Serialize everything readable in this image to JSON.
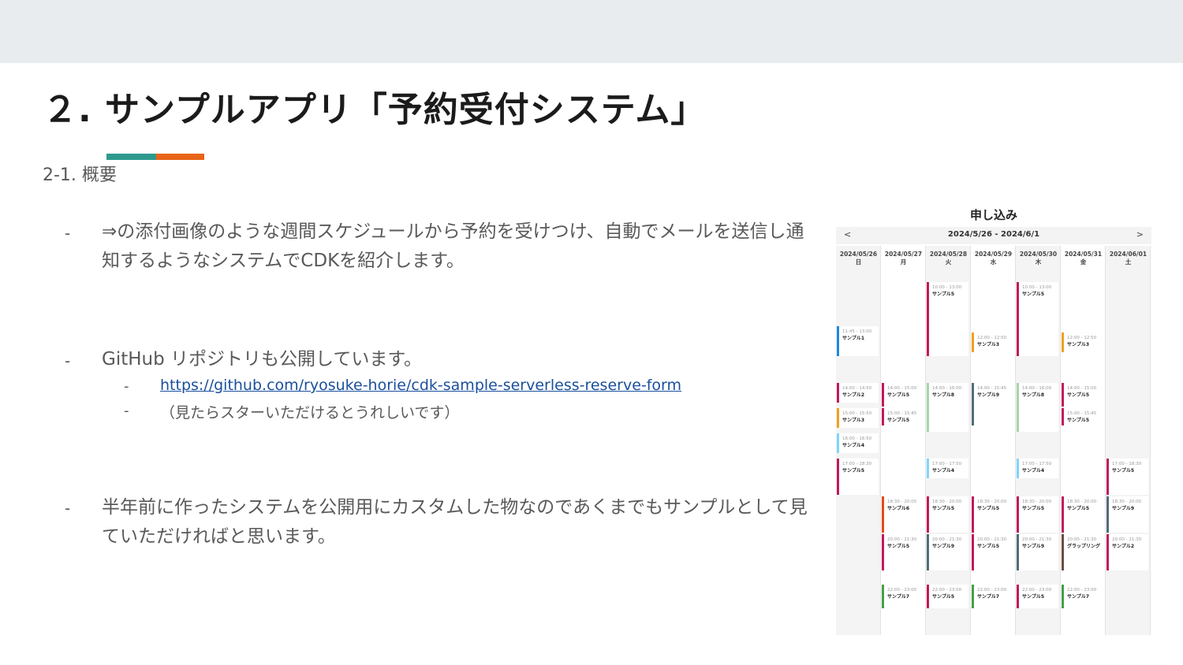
{
  "title": "２. サンプルアプリ「予約受付システム」",
  "subtitle": "2-1. 概要",
  "bullets": {
    "b1": "⇒の添付画像のような週間スケジュールから予約を受けつけ、自動でメールを送信し通知するようなシステムでCDKを紹介します。",
    "b2": "GitHub リポジトリも公開しています。",
    "b2_link": "https://github.com/ryosuke-horie/cdk-sample-serverless-reserve-form",
    "b2_note": "（見たらスターいただけるとうれしいです）",
    "b3": "半年前に作ったシステムを公開用にカスタムした物なのであくまでもサンプルとして見ていただければと思います。",
    "dash": "-"
  },
  "calendar": {
    "heading": "申し込み",
    "prev": "<",
    "next": ">",
    "range": "2024/5/26 - 2024/6/1",
    "colors": {
      "pink": "#c2185b",
      "blue": "#1e88e5",
      "orange": "#f0a020",
      "green": "#a5d6a7",
      "slate": "#4f6d7a",
      "lightblue": "#81d4fa",
      "red": "#e64a19",
      "teal": "#2e7d6a",
      "brown": "#6d4c41",
      "dgreen": "#43a047"
    },
    "days": [
      {
        "date": "2024/05/26",
        "dow": "日",
        "events": [
          {
            "time": "11:45 - 13:00",
            "name": "サンプル1",
            "color": "#1e88e5",
            "start": 11.75,
            "end": 13.0
          },
          {
            "time": "14:00 - 14:50",
            "name": "サンプル2",
            "color": "#c2185b",
            "start": 14.0,
            "end": 14.83
          },
          {
            "time": "15:00 - 15:50",
            "name": "サンプル3",
            "color": "#f0a020",
            "start": 15.0,
            "end": 15.83
          },
          {
            "time": "16:00 - 16:50",
            "name": "サンプル4",
            "color": "#81d4fa",
            "start": 16.0,
            "end": 16.83
          },
          {
            "time": "17:00 - 18:30",
            "name": "サンプル5",
            "color": "#c2185b",
            "start": 17.0,
            "end": 18.5
          }
        ]
      },
      {
        "date": "2024/05/27",
        "dow": "月",
        "events": [
          {
            "time": "14:00 - 15:00",
            "name": "サンプル5",
            "color": "#c2185b",
            "start": 14.0,
            "end": 15.0
          },
          {
            "time": "15:00 - 15:45",
            "name": "サンプル5",
            "color": "#c2185b",
            "start": 15.0,
            "end": 15.75
          },
          {
            "time": "18:30 - 20:00",
            "name": "サンプル6",
            "color": "#e64a19",
            "start": 18.5,
            "end": 20.0
          },
          {
            "time": "20:00 - 21:30",
            "name": "サンプル5",
            "color": "#c2185b",
            "start": 20.0,
            "end": 21.5
          },
          {
            "time": "22:00 - 23:00",
            "name": "サンプル7",
            "color": "#43a047",
            "start": 22.0,
            "end": 23.0
          }
        ]
      },
      {
        "date": "2024/05/28",
        "dow": "火",
        "events": [
          {
            "time": "10:00 - 13:00",
            "name": "サンプル5",
            "color": "#c2185b",
            "start": 10.0,
            "end": 13.0
          },
          {
            "time": "14:00 - 16:00",
            "name": "サンプル8",
            "color": "#a5d6a7",
            "start": 14.0,
            "end": 16.0
          },
          {
            "time": "17:00 - 17:50",
            "name": "サンプル4",
            "color": "#81d4fa",
            "start": 17.0,
            "end": 17.83
          },
          {
            "time": "18:30 - 20:00",
            "name": "サンプル5",
            "color": "#c2185b",
            "start": 18.5,
            "end": 20.0
          },
          {
            "time": "20:00 - 21:30",
            "name": "サンプル9",
            "color": "#4f6d7a",
            "start": 20.0,
            "end": 21.5
          },
          {
            "time": "22:00 - 23:00",
            "name": "サンプル5",
            "color": "#c2185b",
            "start": 22.0,
            "end": 23.0
          }
        ]
      },
      {
        "date": "2024/05/29",
        "dow": "水",
        "events": [
          {
            "time": "12:00 - 12:50",
            "name": "サンプル3",
            "color": "#f0a020",
            "start": 12.0,
            "end": 12.83
          },
          {
            "time": "14:00 - 15:45",
            "name": "サンプル9",
            "color": "#4f6d7a",
            "start": 14.0,
            "end": 15.75
          },
          {
            "time": "18:30 - 20:00",
            "name": "サンプル5",
            "color": "#c2185b",
            "start": 18.5,
            "end": 20.0
          },
          {
            "time": "20:00 - 21:30",
            "name": "サンプル5",
            "color": "#c2185b",
            "start": 20.0,
            "end": 21.5
          },
          {
            "time": "22:00 - 23:00",
            "name": "サンプル7",
            "color": "#43a047",
            "start": 22.0,
            "end": 23.0
          }
        ]
      },
      {
        "date": "2024/05/30",
        "dow": "木",
        "events": [
          {
            "time": "10:00 - 13:00",
            "name": "サンプル5",
            "color": "#c2185b",
            "start": 10.0,
            "end": 13.0
          },
          {
            "time": "14:00 - 16:00",
            "name": "サンプル8",
            "color": "#a5d6a7",
            "start": 14.0,
            "end": 16.0
          },
          {
            "time": "17:00 - 17:50",
            "name": "サンプル4",
            "color": "#81d4fa",
            "start": 17.0,
            "end": 17.83
          },
          {
            "time": "18:30 - 20:00",
            "name": "サンプル5",
            "color": "#c2185b",
            "start": 18.5,
            "end": 20.0
          },
          {
            "time": "20:00 - 21:30",
            "name": "サンプル9",
            "color": "#4f6d7a",
            "start": 20.0,
            "end": 21.5
          },
          {
            "time": "22:00 - 23:00",
            "name": "サンプル5",
            "color": "#c2185b",
            "start": 22.0,
            "end": 23.0
          }
        ]
      },
      {
        "date": "2024/05/31",
        "dow": "金",
        "events": [
          {
            "time": "12:00 - 12:50",
            "name": "サンプル3",
            "color": "#f0a020",
            "start": 12.0,
            "end": 12.83
          },
          {
            "time": "14:00 - 15:00",
            "name": "サンプル5",
            "color": "#c2185b",
            "start": 14.0,
            "end": 15.0
          },
          {
            "time": "15:00 - 15:45",
            "name": "サンプル5",
            "color": "#c2185b",
            "start": 15.0,
            "end": 15.75
          },
          {
            "time": "18:30 - 20:00",
            "name": "サンプル5",
            "color": "#c2185b",
            "start": 18.5,
            "end": 20.0
          },
          {
            "time": "20:00 - 21:30",
            "name": "グラップリング",
            "color": "#6d4c41",
            "start": 20.0,
            "end": 21.5
          },
          {
            "time": "22:00 - 23:00",
            "name": "サンプル7",
            "color": "#43a047",
            "start": 22.0,
            "end": 23.0
          }
        ]
      },
      {
        "date": "2024/06/01",
        "dow": "土",
        "events": [
          {
            "time": "17:00 - 18:30",
            "name": "サンプル5",
            "color": "#c2185b",
            "start": 17.0,
            "end": 18.5
          },
          {
            "time": "18:30 - 20:00",
            "name": "サンプル9",
            "color": "#4f6d7a",
            "start": 18.5,
            "end": 20.0
          },
          {
            "time": "20:00 - 21:30",
            "name": "サンプル2",
            "color": "#c2185b",
            "start": 20.0,
            "end": 21.5
          }
        ]
      }
    ]
  }
}
